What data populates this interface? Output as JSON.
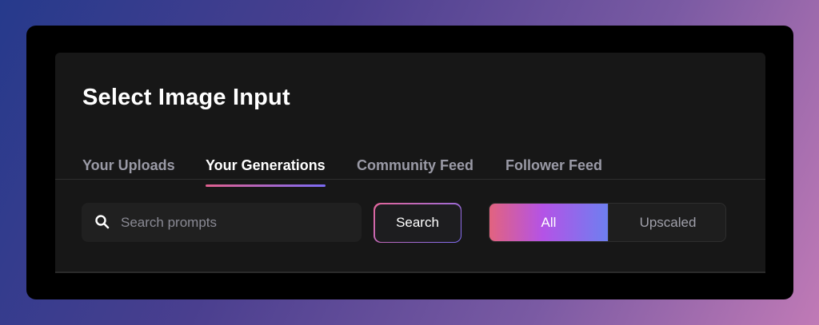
{
  "dialog": {
    "title": "Select Image Input"
  },
  "tabs": [
    {
      "label": "Your Uploads",
      "active": false
    },
    {
      "label": "Your Generations",
      "active": true
    },
    {
      "label": "Community Feed",
      "active": false
    },
    {
      "label": "Follower Feed",
      "active": false
    }
  ],
  "search": {
    "placeholder": "Search prompts",
    "value": "",
    "button_label": "Search",
    "icon": "search-icon"
  },
  "filter": {
    "options": [
      "All",
      "Upscaled"
    ],
    "selected": "All"
  },
  "colors": {
    "accent_gradient_start": "#e2637f",
    "accent_gradient_mid": "#b453e6",
    "accent_gradient_end": "#6e7ff0",
    "panel_background": "#171717"
  }
}
